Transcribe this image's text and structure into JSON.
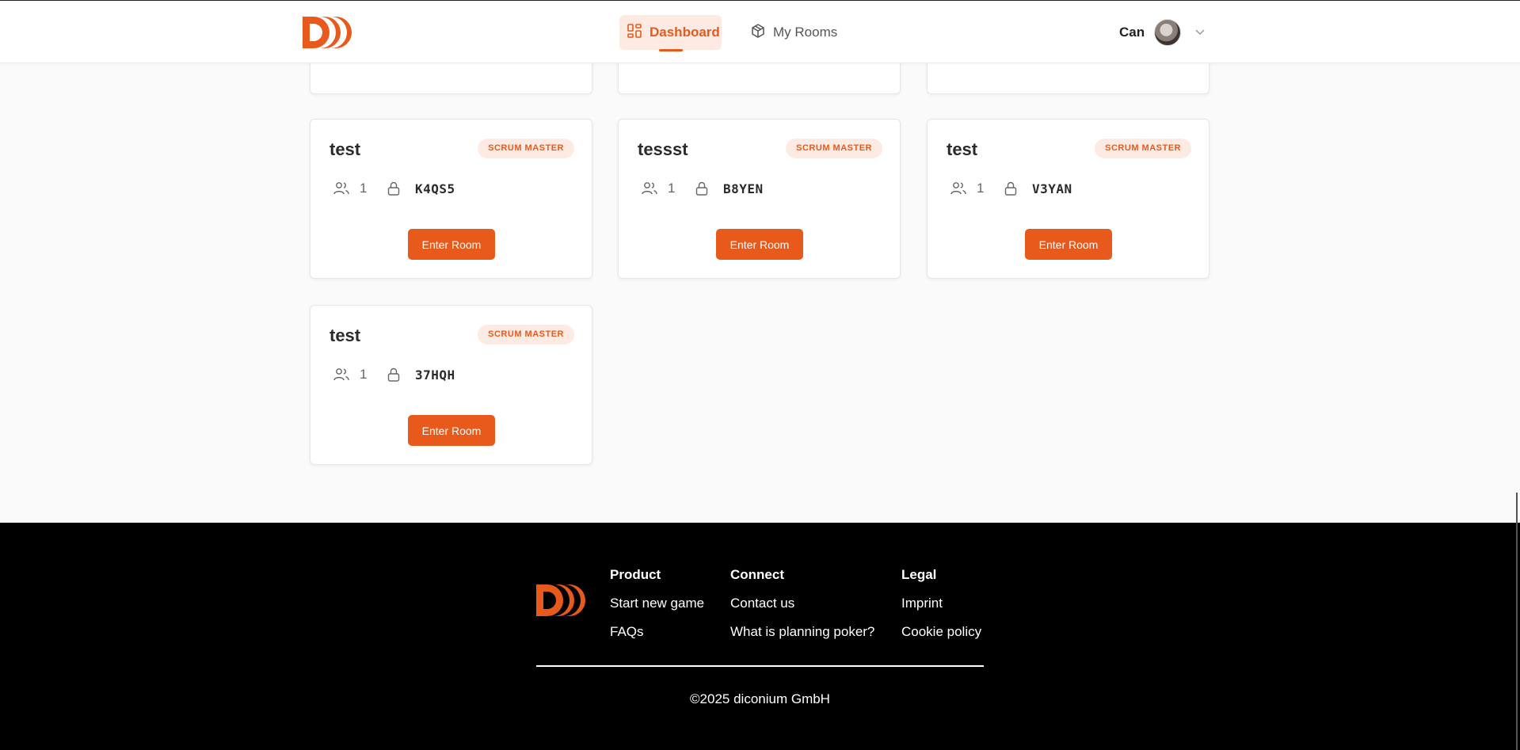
{
  "header": {
    "nav": {
      "dashboard_label": "Dashboard",
      "rooms_label": "My Rooms"
    },
    "user": {
      "name": "Can"
    }
  },
  "colors": {
    "accent": "#e85a1c",
    "badge_bg": "#fdebe3",
    "footer_bg": "#000000"
  },
  "rooms": {
    "enter_label": "Enter Room",
    "role_label": "SCRUM MASTER",
    "items": [
      {
        "name": "test",
        "members": "1",
        "code": "K4QS5"
      },
      {
        "name": "tessst",
        "members": "1",
        "code": "B8YEN"
      },
      {
        "name": "test",
        "members": "1",
        "code": "V3YAN"
      },
      {
        "name": "test",
        "members": "1",
        "code": "37HQH"
      }
    ]
  },
  "footer": {
    "product": {
      "heading": "Product",
      "links": [
        "Start new game",
        "FAQs"
      ]
    },
    "connect": {
      "heading": "Connect",
      "links": [
        "Contact us",
        "What is planning poker?"
      ]
    },
    "legal": {
      "heading": "Legal",
      "links": [
        "Imprint",
        "Cookie policy"
      ]
    },
    "copyright": "©2025 diconium GmbH"
  },
  "icons": {
    "logo": "diconium-logo",
    "dashboard": "dashboard-grid-icon",
    "rooms": "cube-icon",
    "members": "users-icon",
    "lock": "lock-icon",
    "menu": "chevron-down-icon"
  }
}
